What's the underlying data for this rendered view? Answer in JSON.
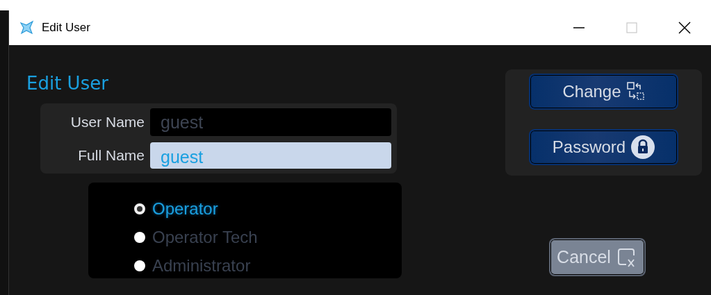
{
  "window": {
    "title": "Edit User",
    "controls": [
      {
        "kind": "minimize",
        "disabled": false
      },
      {
        "kind": "maximize",
        "disabled": true
      },
      {
        "kind": "close",
        "disabled": false
      }
    ]
  },
  "heading": "Edit User",
  "fields": [
    {
      "label": "User Name",
      "value": "guest",
      "disabled": true
    },
    {
      "label": "Full Name",
      "value": "guest",
      "disabled": false
    }
  ],
  "roles": [
    {
      "label": "Operator",
      "selected": true
    },
    {
      "label": "Operator Tech",
      "selected": false
    },
    {
      "label": "Administrator",
      "selected": false
    }
  ],
  "actions": [
    {
      "label": "Change",
      "kind": "change",
      "disabled": false
    },
    {
      "label": "Password",
      "kind": "password",
      "disabled": false
    }
  ],
  "cancel": {
    "label": "Cancel",
    "disabled": true
  }
}
